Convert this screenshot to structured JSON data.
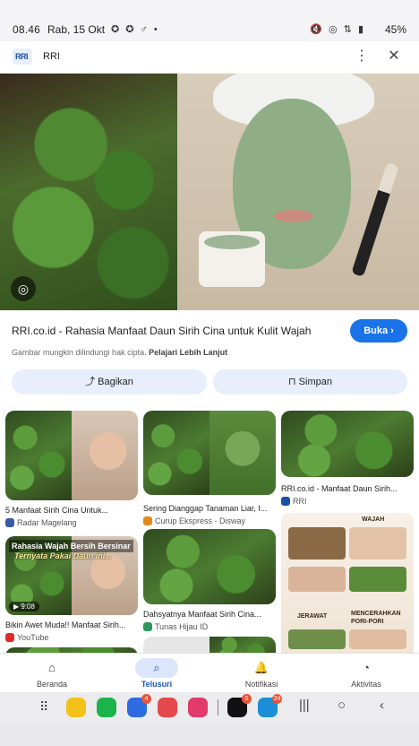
{
  "status_bar": {
    "time": "08.46",
    "date": "Rab, 15 Okt",
    "left_icons": "✪ ✪ ♂ •",
    "right_icons": "🔇 ◎ ⇅ ▮",
    "battery": "45%"
  },
  "header": {
    "logo_text": "RRI",
    "site_name": "RRI",
    "more_icon": "⋮",
    "close_icon": "✕"
  },
  "hero": {
    "lens_icon": "◎"
  },
  "detail": {
    "title": "RRI.co.id - Rahasia Manfaat Daun Sirih Cina untuk Kulit Wajah",
    "open_button": "Buka ›",
    "copyright_prefix": "Gambar mungkin dilindungi hak cipta.",
    "copyright_link": "Pelajari Lebih Lanjut",
    "share_button": "⤴ Bagikan",
    "save_button": "⊓ Simpan"
  },
  "results": [
    {
      "caption": "5 Manfaat Sirih Cina Untuk...",
      "source": "Radar Magelang"
    },
    {
      "caption": "Sering Dianggap Tanaman Liar, I...",
      "source": "Curup Ekspress - Disway"
    },
    {
      "caption": "RRI.co.id - Manfaat Daun Sirih...",
      "source": "RRI"
    },
    {
      "caption": "Bikin Awet Muda!! Manfaat Sirih...",
      "source": "YouTube",
      "overlay": "Rahasia Wajah Bersih Bersinar",
      "overlay2": "Ternyata Pakai Daun ini...",
      "duration": "▶ 9:08"
    },
    {
      "caption": "Dahsyatnya Manfaat Sirih Cina...",
      "source": "Tunas Hijau ID"
    },
    {
      "info_top": "WAJAH",
      "info_mid_left": "JERAWAT",
      "info_mid_right": "MENCERAHKAN PORI-PORI"
    }
  ],
  "bottom_nav": [
    {
      "icon": "⌂",
      "label": "Beranda"
    },
    {
      "icon": "⌕",
      "label": "Telusuri"
    },
    {
      "icon": "🔔",
      "label": "Notifikasi"
    },
    {
      "icon": "◔",
      "label": "Aktivitas"
    }
  ],
  "taskbar": {
    "apps_icon": "⠿",
    "badges": [
      "4",
      "5",
      "24"
    ],
    "recents_icon": "|||",
    "home_icon": "○",
    "back_icon": "‹"
  }
}
